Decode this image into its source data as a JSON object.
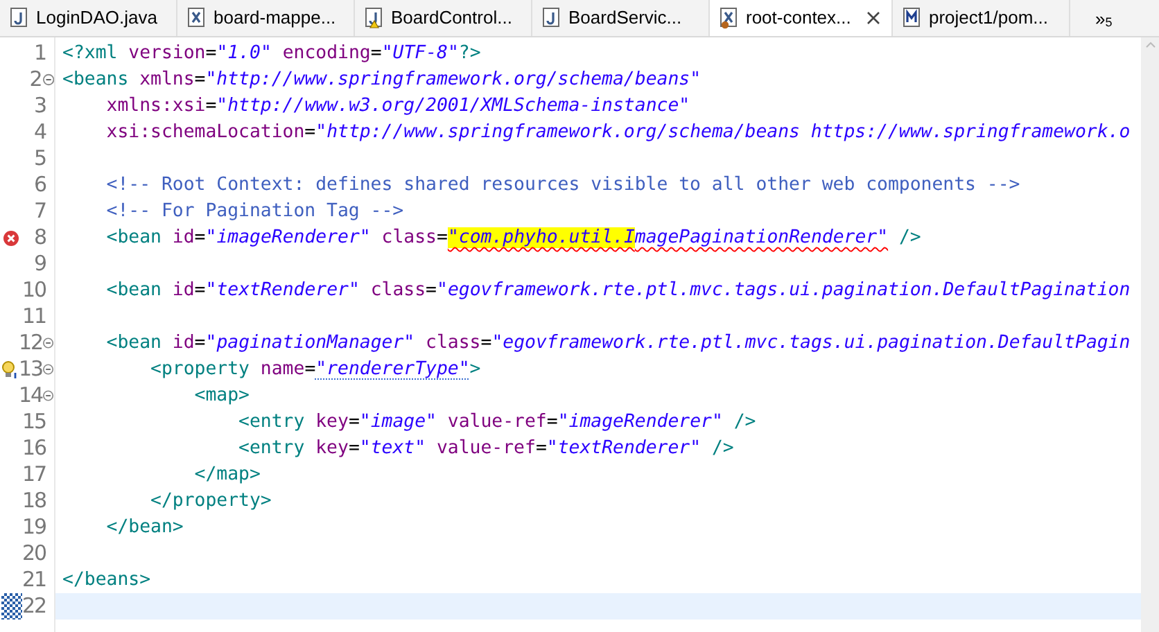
{
  "tabs": [
    {
      "label": "LoginDAO.java",
      "kind": "java",
      "warning": false,
      "error": false,
      "selected": false
    },
    {
      "label": "board-mappe...",
      "kind": "xml",
      "warning": false,
      "error": false,
      "selected": false
    },
    {
      "label": "BoardControl...",
      "kind": "java",
      "warning": true,
      "error": false,
      "selected": false
    },
    {
      "label": "BoardServic...",
      "kind": "java",
      "warning": false,
      "error": false,
      "selected": false
    },
    {
      "label": "root-contex...",
      "kind": "xml",
      "warning": false,
      "error": true,
      "selected": true
    },
    {
      "label": "project1/pom...",
      "kind": "maven",
      "warning": false,
      "error": false,
      "selected": false
    }
  ],
  "overflow": {
    "glyph": "»",
    "count": "5"
  },
  "editor": {
    "lines": [
      {
        "number": "1",
        "error": false,
        "info": false,
        "fold": false,
        "current": false,
        "tokens": [
          {
            "kind": "tag",
            "text": "<?xml"
          },
          {
            "kind": "attr",
            "text": " version"
          },
          {
            "kind": "plain",
            "text": "="
          },
          {
            "kind": "value",
            "text": "\"1.0\""
          },
          {
            "kind": "attr",
            "text": " encoding"
          },
          {
            "kind": "plain",
            "text": "="
          },
          {
            "kind": "value",
            "text": "\"UTF-8\""
          },
          {
            "kind": "tag",
            "text": "?>"
          }
        ]
      },
      {
        "number": "2",
        "error": false,
        "info": false,
        "fold": true,
        "current": false,
        "tokens": [
          {
            "kind": "tag",
            "text": "<beans"
          },
          {
            "kind": "attr",
            "text": " xmlns"
          },
          {
            "kind": "plain",
            "text": "="
          },
          {
            "kind": "value",
            "text": "\"http://www.springframework.org/schema/beans\""
          }
        ]
      },
      {
        "number": "3",
        "error": false,
        "info": false,
        "fold": false,
        "current": false,
        "tokens": [
          {
            "kind": "attr",
            "text": "    xmlns:xsi"
          },
          {
            "kind": "plain",
            "text": "="
          },
          {
            "kind": "value",
            "text": "\"http://www.w3.org/2001/XMLSchema-instance\""
          }
        ]
      },
      {
        "number": "4",
        "error": false,
        "info": false,
        "fold": false,
        "current": false,
        "tokens": [
          {
            "kind": "attr",
            "text": "    xsi:schemaLocation"
          },
          {
            "kind": "plain",
            "text": "="
          },
          {
            "kind": "value",
            "text": "\"http://www.springframework.org/schema/beans https://www.springframework.o"
          }
        ]
      },
      {
        "number": "5",
        "error": false,
        "info": false,
        "fold": false,
        "current": false
      },
      {
        "number": "6",
        "error": false,
        "info": false,
        "fold": false,
        "current": false,
        "tokens": [
          {
            "kind": "comment",
            "text": "    <!-- Root Context: defines shared resources visible to all other web components -->"
          }
        ]
      },
      {
        "number": "7",
        "error": false,
        "info": false,
        "fold": false,
        "current": false,
        "tokens": [
          {
            "kind": "comment",
            "text": "    <!-- For Pagination Tag -->"
          }
        ]
      },
      {
        "number": "8",
        "error": true,
        "info": false,
        "fold": false,
        "current": false,
        "tokens": [
          {
            "kind": "tag",
            "text": "    <bean"
          },
          {
            "kind": "attr",
            "text": " id"
          },
          {
            "kind": "plain",
            "text": "="
          },
          {
            "kind": "value",
            "text": "\"imageRenderer\""
          },
          {
            "kind": "attr",
            "text": " class"
          },
          {
            "kind": "plain",
            "text": "="
          },
          {
            "kind": "value",
            "text": "\"com.phyho.util.I",
            "highlighted": true,
            "error": true
          },
          {
            "kind": "value",
            "text": "magePaginationRenderer\"",
            "highlighted": false,
            "error": true
          },
          {
            "kind": "tag",
            "text": " />"
          }
        ]
      },
      {
        "number": "9",
        "error": false,
        "info": false,
        "fold": false,
        "current": false
      },
      {
        "number": "10",
        "error": false,
        "info": false,
        "fold": false,
        "current": false,
        "tokens": [
          {
            "kind": "tag",
            "text": "    <bean"
          },
          {
            "kind": "attr",
            "text": " id"
          },
          {
            "kind": "plain",
            "text": "="
          },
          {
            "kind": "value",
            "text": "\"textRenderer\""
          },
          {
            "kind": "attr",
            "text": " class"
          },
          {
            "kind": "plain",
            "text": "="
          },
          {
            "kind": "value",
            "text": "\"egovframework.rte.ptl.mvc.tags.ui.pagination.DefaultPagination"
          }
        ]
      },
      {
        "number": "11",
        "error": false,
        "info": false,
        "fold": false,
        "current": false
      },
      {
        "number": "12",
        "error": false,
        "info": false,
        "fold": true,
        "current": false,
        "tokens": [
          {
            "kind": "tag",
            "text": "    <bean"
          },
          {
            "kind": "attr",
            "text": " id"
          },
          {
            "kind": "plain",
            "text": "="
          },
          {
            "kind": "value",
            "text": "\"paginationManager\""
          },
          {
            "kind": "attr",
            "text": " class"
          },
          {
            "kind": "plain",
            "text": "="
          },
          {
            "kind": "value",
            "text": "\"egovframework.rte.ptl.mvc.tags.ui.pagination.DefaultPagin"
          }
        ]
      },
      {
        "number": "13",
        "error": false,
        "info": true,
        "fold": true,
        "current": false,
        "tokens": [
          {
            "kind": "tag",
            "text": "        <property"
          },
          {
            "kind": "attr",
            "text": " name"
          },
          {
            "kind": "plain",
            "text": "="
          },
          {
            "kind": "value",
            "text": "\"rendererType\"",
            "info": true
          },
          {
            "kind": "tag",
            "text": ">"
          }
        ]
      },
      {
        "number": "14",
        "error": false,
        "info": false,
        "fold": true,
        "current": false,
        "tokens": [
          {
            "kind": "tag",
            "text": "            <map>"
          }
        ]
      },
      {
        "number": "15",
        "error": false,
        "info": false,
        "fold": false,
        "current": false,
        "tokens": [
          {
            "kind": "tag",
            "text": "                <entry"
          },
          {
            "kind": "attr",
            "text": " key"
          },
          {
            "kind": "plain",
            "text": "="
          },
          {
            "kind": "value",
            "text": "\"image\""
          },
          {
            "kind": "attr",
            "text": " value-ref"
          },
          {
            "kind": "plain",
            "text": "="
          },
          {
            "kind": "value",
            "text": "\"imageRenderer\""
          },
          {
            "kind": "tag",
            "text": " />"
          }
        ]
      },
      {
        "number": "16",
        "error": false,
        "info": false,
        "fold": false,
        "current": false,
        "tokens": [
          {
            "kind": "tag",
            "text": "                <entry"
          },
          {
            "kind": "attr",
            "text": " key"
          },
          {
            "kind": "plain",
            "text": "="
          },
          {
            "kind": "value",
            "text": "\"text\""
          },
          {
            "kind": "attr",
            "text": " value-ref"
          },
          {
            "kind": "plain",
            "text": "="
          },
          {
            "kind": "value",
            "text": "\"textRenderer\""
          },
          {
            "kind": "tag",
            "text": " />"
          }
        ]
      },
      {
        "number": "17",
        "error": false,
        "info": false,
        "fold": false,
        "current": false,
        "tokens": [
          {
            "kind": "tag",
            "text": "            </map>"
          }
        ]
      },
      {
        "number": "18",
        "error": false,
        "info": false,
        "fold": false,
        "current": false,
        "tokens": [
          {
            "kind": "tag",
            "text": "        </property>"
          }
        ]
      },
      {
        "number": "19",
        "error": false,
        "info": false,
        "fold": false,
        "current": false,
        "tokens": [
          {
            "kind": "tag",
            "text": "    </bean>"
          }
        ]
      },
      {
        "number": "20",
        "error": false,
        "info": false,
        "fold": false,
        "current": false
      },
      {
        "number": "21",
        "error": false,
        "info": false,
        "fold": false,
        "current": false,
        "tokens": [
          {
            "kind": "tag",
            "text": "</beans>"
          }
        ]
      },
      {
        "number": "22",
        "error": false,
        "info": false,
        "fold": false,
        "current": true
      }
    ]
  }
}
